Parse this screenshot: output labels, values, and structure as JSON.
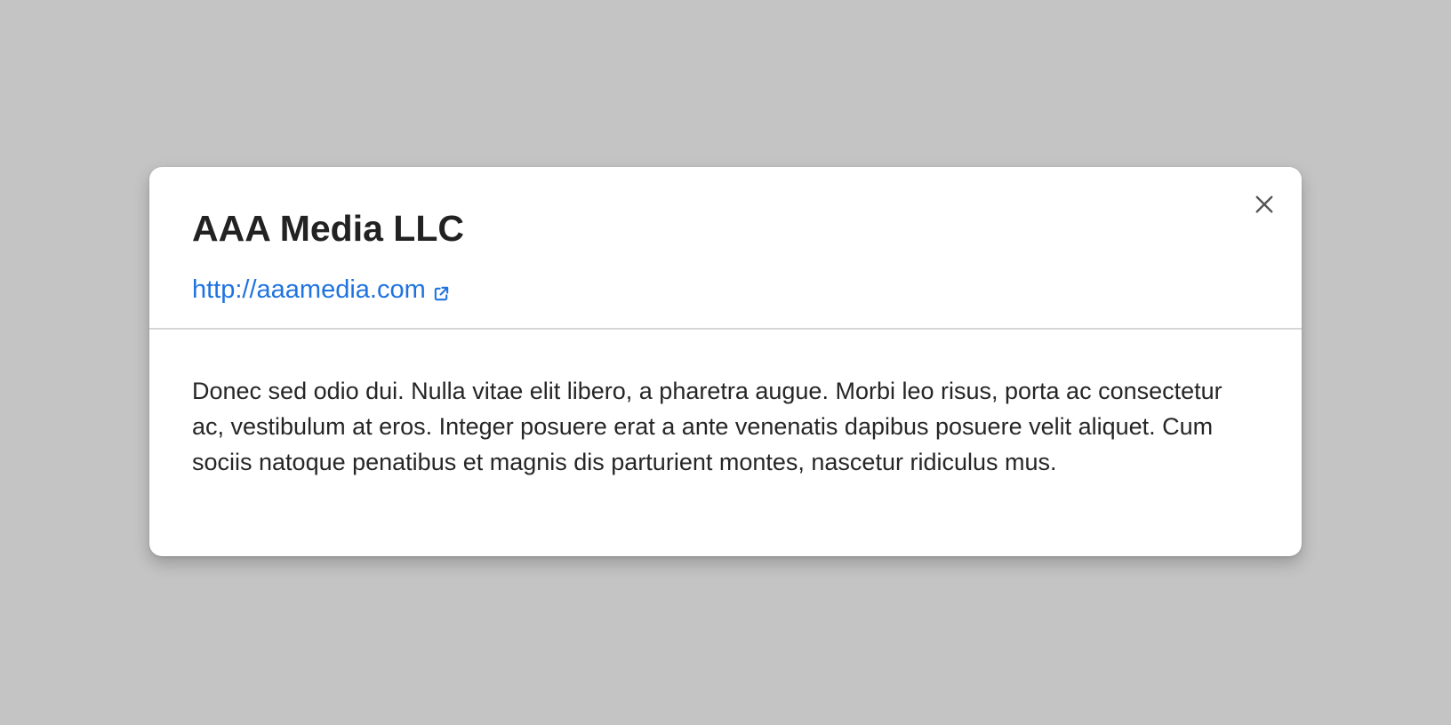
{
  "dialog": {
    "title": "AAA Media LLC",
    "link": {
      "text": "http://aaamedia.com",
      "icon": "external-link-icon",
      "color": "#1f73e0"
    },
    "close_icon": "close-icon",
    "body": "Donec sed odio dui. Nulla vitae elit libero, a pharetra augue. Morbi leo risus, porta ac consectetur ac, vestibulum at eros. Integer posuere erat a ante venenatis dapibus posuere velit aliquet. Cum sociis natoque penatibus et magnis dis parturient montes, nascetur ridiculus mus."
  },
  "colors": {
    "backdrop": "#c4c4c4",
    "surface": "#ffffff",
    "title": "#222222",
    "body_text": "#262626",
    "divider": "#d6d6d6"
  }
}
